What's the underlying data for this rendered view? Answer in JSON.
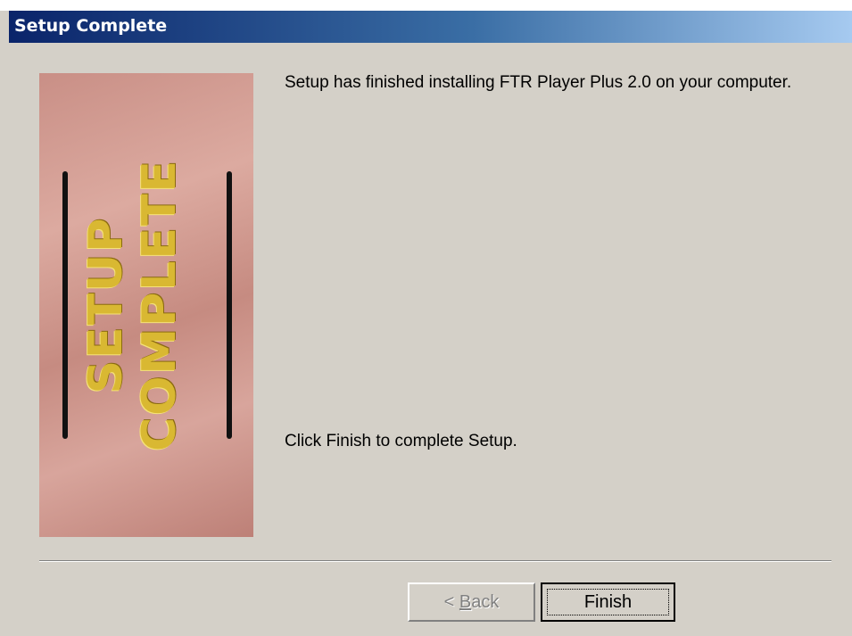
{
  "window": {
    "title": "Setup Complete"
  },
  "banner": {
    "word_top": "SETUP",
    "word_bottom": "COMPLETE"
  },
  "content": {
    "message": "Setup has finished installing FTR Player Plus 2.0 on your computer.",
    "instruction": "Click Finish to complete Setup."
  },
  "buttons": {
    "back": {
      "prefix": "< ",
      "accel": "B",
      "rest": "ack",
      "enabled": false
    },
    "finish": {
      "label": "Finish",
      "enabled": true
    }
  },
  "colors": {
    "title_bar_start": "#0a246a",
    "title_bar_end": "#a6caf0",
    "dialog_face": "#d4d0c8",
    "banner_rose": "#c98f86",
    "banner_gold": "#d9b832"
  }
}
